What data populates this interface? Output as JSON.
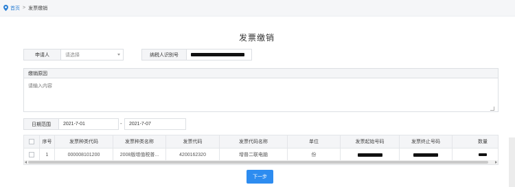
{
  "breadcrumb": {
    "home": "首页",
    "separator": ">",
    "current": "发票缴销"
  },
  "form": {
    "title": "发票缴销",
    "applicant": {
      "label": "申请人",
      "placeholder": "请选择"
    },
    "taxpayer_id": {
      "label": "纳税人识别号"
    },
    "reason": {
      "label": "缴销原因",
      "placeholder": "请输入内容"
    },
    "date_range": {
      "label": "日期范围",
      "start": "2021-7-01",
      "separator": "-",
      "end": "2021-7-07"
    }
  },
  "table": {
    "headers": [
      "序号",
      "发票种类代码",
      "发票种类名称",
      "发票代码",
      "发票代码名称",
      "单位",
      "发票起始号码",
      "发票终止号码",
      "数量"
    ],
    "rows": [
      {
        "index": "1",
        "kind_code": "000008101200",
        "kind_name": "2008版增值税普...",
        "invoice_code": "4200162320",
        "code_name": "增普二联电脑",
        "unit": "份"
      }
    ]
  },
  "actions": {
    "next_label": "下一步"
  },
  "icons": {
    "breadcrumb": "location-pin-icon",
    "select": "chevron-down-icon"
  },
  "colors": {
    "primary": "#2d8cf0",
    "link": "#2a7fd4",
    "header_bg": "#f4f5f7",
    "redaction": "#111111"
  }
}
